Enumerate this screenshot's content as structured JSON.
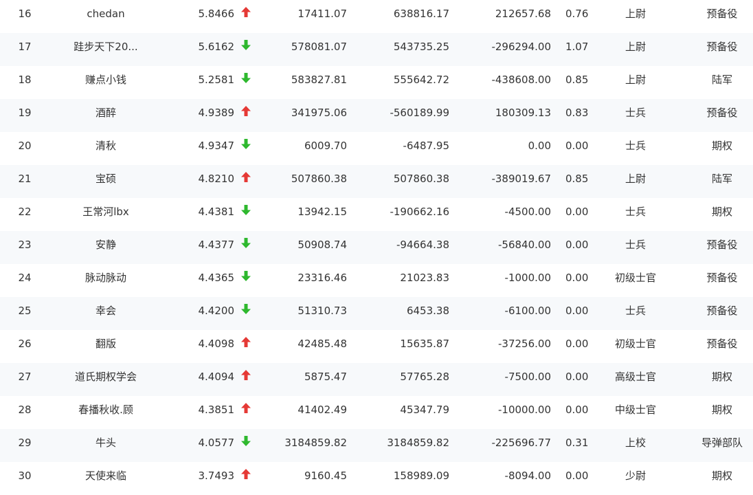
{
  "colors": {
    "up": "#e53935",
    "down": "#2eb82e",
    "text": "#333333"
  },
  "rows": [
    {
      "rank": "16",
      "name": "chedan",
      "score": "5.8466",
      "trend": "up",
      "icon": "red-up-arrow-icon",
      "v1": "17411.07",
      "v2": "638816.17",
      "v3": "212657.68",
      "v4": "0.76",
      "level": "上尉",
      "branch": "预备役"
    },
    {
      "rank": "17",
      "name": "跬步天下20...",
      "score": "5.6162",
      "trend": "down",
      "icon": "green-down-arrow-icon",
      "v1": "578081.07",
      "v2": "543735.25",
      "v3": "-296294.00",
      "v4": "1.07",
      "level": "上尉",
      "branch": "预备役"
    },
    {
      "rank": "18",
      "name": "赚点小钱",
      "score": "5.2581",
      "trend": "down",
      "icon": "green-down-arrow-icon",
      "v1": "583827.81",
      "v2": "555642.72",
      "v3": "-438608.00",
      "v4": "0.85",
      "level": "上尉",
      "branch": "陆军"
    },
    {
      "rank": "19",
      "name": "酒醉",
      "score": "4.9389",
      "trend": "up",
      "icon": "red-up-arrow-icon",
      "v1": "341975.06",
      "v2": "-560189.99",
      "v3": "180309.13",
      "v4": "0.83",
      "level": "士兵",
      "branch": "预备役"
    },
    {
      "rank": "20",
      "name": "清秋",
      "score": "4.9347",
      "trend": "down",
      "icon": "green-down-arrow-icon",
      "v1": "6009.70",
      "v2": "-6487.95",
      "v3": "0.00",
      "v4": "0.00",
      "level": "士兵",
      "branch": "期权"
    },
    {
      "rank": "21",
      "name": "宝硕",
      "score": "4.8210",
      "trend": "up",
      "icon": "red-up-arrow-icon",
      "v1": "507860.38",
      "v2": "507860.38",
      "v3": "-389019.67",
      "v4": "0.85",
      "level": "上尉",
      "branch": "陆军"
    },
    {
      "rank": "22",
      "name": "王常河lbx",
      "score": "4.4381",
      "trend": "down",
      "icon": "green-down-arrow-icon",
      "v1": "13942.15",
      "v2": "-190662.16",
      "v3": "-4500.00",
      "v4": "0.00",
      "level": "士兵",
      "branch": "期权"
    },
    {
      "rank": "23",
      "name": "安静",
      "score": "4.4377",
      "trend": "down",
      "icon": "green-down-arrow-icon",
      "v1": "50908.74",
      "v2": "-94664.38",
      "v3": "-56840.00",
      "v4": "0.00",
      "level": "士兵",
      "branch": "预备役"
    },
    {
      "rank": "24",
      "name": "脉动脉动",
      "score": "4.4365",
      "trend": "down",
      "icon": "green-down-arrow-icon",
      "v1": "23316.46",
      "v2": "21023.83",
      "v3": "-1000.00",
      "v4": "0.00",
      "level": "初级士官",
      "branch": "预备役"
    },
    {
      "rank": "25",
      "name": "幸会",
      "score": "4.4200",
      "trend": "down",
      "icon": "green-down-arrow-icon",
      "v1": "51310.73",
      "v2": "6453.38",
      "v3": "-6100.00",
      "v4": "0.00",
      "level": "士兵",
      "branch": "预备役"
    },
    {
      "rank": "26",
      "name": "翻版",
      "score": "4.4098",
      "trend": "up",
      "icon": "red-up-arrow-icon",
      "v1": "42485.48",
      "v2": "15635.87",
      "v3": "-37256.00",
      "v4": "0.00",
      "level": "初级士官",
      "branch": "预备役"
    },
    {
      "rank": "27",
      "name": "道氏期权学会",
      "score": "4.4094",
      "trend": "up",
      "icon": "red-up-arrow-icon",
      "v1": "5875.47",
      "v2": "57765.28",
      "v3": "-7500.00",
      "v4": "0.00",
      "level": "高级士官",
      "branch": "期权"
    },
    {
      "rank": "28",
      "name": "春播秋收.顾",
      "score": "4.3851",
      "trend": "up",
      "icon": "red-up-arrow-icon",
      "v1": "41402.49",
      "v2": "45347.79",
      "v3": "-10000.00",
      "v4": "0.00",
      "level": "中级士官",
      "branch": "期权"
    },
    {
      "rank": "29",
      "name": "牛头",
      "score": "4.0577",
      "trend": "down",
      "icon": "green-down-arrow-icon",
      "v1": "3184859.82",
      "v2": "3184859.82",
      "v3": "-225696.77",
      "v4": "0.31",
      "level": "上校",
      "branch": "导弹部队"
    },
    {
      "rank": "30",
      "name": "天使来临",
      "score": "3.7493",
      "trend": "up",
      "icon": "red-up-arrow-icon",
      "v1": "9160.45",
      "v2": "158989.09",
      "v3": "-8094.00",
      "v4": "0.00",
      "level": "少尉",
      "branch": "期权"
    }
  ]
}
